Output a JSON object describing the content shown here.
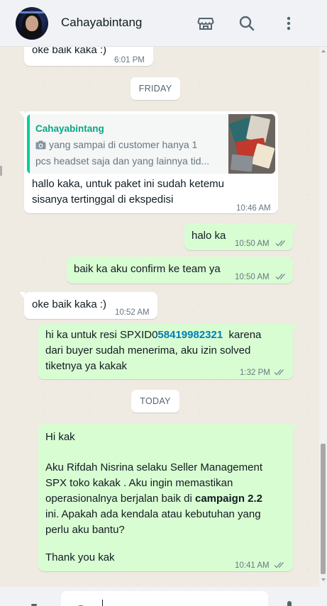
{
  "header": {
    "contact_name": "Cahayabintang",
    "icons": [
      "shop-icon",
      "search-icon",
      "more-vertical-icon"
    ]
  },
  "colors": {
    "incoming_bubble": "#ffffff",
    "outgoing_bubble": "#d9fdd3",
    "quote_accent": "#06cf9c",
    "link": "#027eb5",
    "read_ticks": "#8696a0"
  },
  "messages": [
    {
      "id": "m0",
      "direction": "in",
      "lines": [
        "oke baik kaka :)"
      ],
      "time": "6:01 PM"
    },
    {
      "id": "chip1",
      "type": "date",
      "label": "FRIDAY"
    },
    {
      "id": "m1",
      "direction": "in",
      "quote": {
        "name": "Cahayabintang",
        "lines": [
          "yang sampai di customer hanya 1",
          "pcs headset saja dan yang lainnya tid..."
        ],
        "has_photo": true
      },
      "lines": [
        "hallo kaka, untuk paket ini sudah ketemu",
        "sisanya tertinggal di ekspedisi"
      ],
      "time": "10:46 AM"
    },
    {
      "id": "m2",
      "direction": "out",
      "lines": [
        "halo ka"
      ],
      "time": "10:50 AM",
      "status": "read"
    },
    {
      "id": "m3",
      "direction": "out",
      "lines": [
        "baik ka aku confirm ke team ya"
      ],
      "time": "10:50 AM",
      "status": "read"
    },
    {
      "id": "m4",
      "direction": "in",
      "lines": [
        "oke baik kaka :)"
      ],
      "time": "10:52 AM"
    },
    {
      "id": "m5",
      "direction": "out",
      "line1_prefix": "hi ka untuk resi SPXID0",
      "line1_link": "58419982321",
      "line1_suffix": "  karena",
      "lines": [
        "dari buyer sudah menerima, aku izin solved",
        "tiketnya ya kakak"
      ],
      "time": "1:32 PM",
      "status": "read"
    },
    {
      "id": "chip2",
      "type": "date",
      "label": "TODAY"
    },
    {
      "id": "m6",
      "direction": "out",
      "greeting": "Hi kak",
      "para_lines": [
        "Aku Rifdah Nisrina selaku Seller Management",
        "SPX toko kakak . Aku ingin memastikan"
      ],
      "line3_prefix": "operasionalnya berjalan baik di ",
      "line3_bold": "campaign 2.2",
      "tail_lines": [
        "ini. Apakah ada kendala atau kebutuhan yang",
        "perlu aku bantu?"
      ],
      "closing": "Thank you kak",
      "time": "10:41 AM",
      "status": "read"
    }
  ],
  "composer": {
    "placeholder_glyph": "I"
  }
}
